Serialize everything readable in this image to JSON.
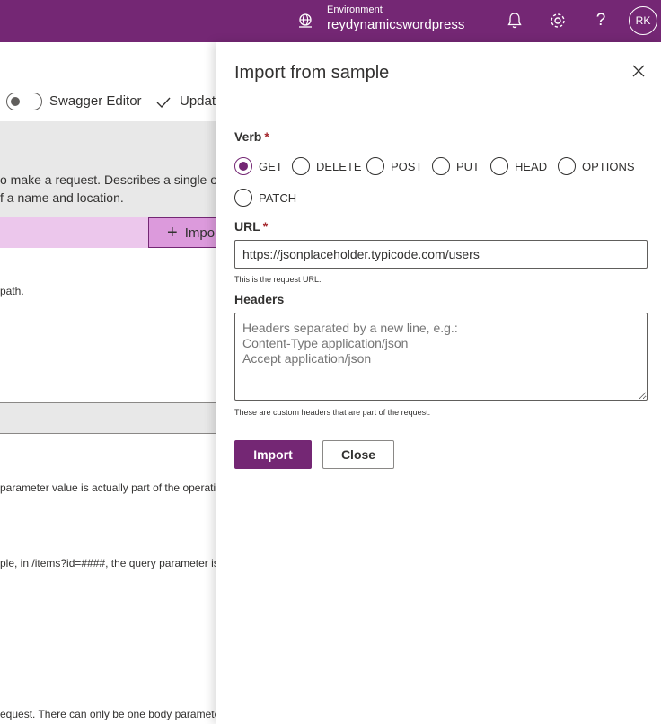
{
  "topbar": {
    "environment_label": "Environment",
    "environment_name": "reydynamicswordpress",
    "avatar_initials": "RK",
    "help_glyph": "?",
    "icons": [
      "environment-icon",
      "bell-icon",
      "gear-icon",
      "help-icon"
    ]
  },
  "background": {
    "toggle_label": "Swagger Editor",
    "update_label": "Update",
    "desc_line1": "o make a request. Describes a single op",
    "desc_line2": "f a name and location.",
    "import_label": "Impo",
    "path_text": "path.",
    "param_text": "parameter value is actually part of the operatio",
    "query_text": "ple, in /items?id=####, the query parameter is",
    "body_text": "equest. There can only be one body paramete"
  },
  "panel": {
    "title": "Import from sample",
    "verb": {
      "label": "Verb",
      "required": "*",
      "options": [
        "GET",
        "DELETE",
        "POST",
        "PUT",
        "HEAD",
        "OPTIONS",
        "PATCH"
      ],
      "selected": "GET"
    },
    "url": {
      "label": "URL",
      "required": "*",
      "value": "https://jsonplaceholder.typicode.com/users",
      "hint": "This is the request URL."
    },
    "headers": {
      "label": "Headers",
      "placeholder": "Headers separated by a new line, e.g.:\nContent-Type application/json\nAccept application/json",
      "hint": "These are custom headers that are part of the request."
    },
    "import_button": "Import",
    "close_button": "Close"
  },
  "colors": {
    "brand": "#742774",
    "required": "#a4262c",
    "highlight": "#ecc7ec"
  }
}
